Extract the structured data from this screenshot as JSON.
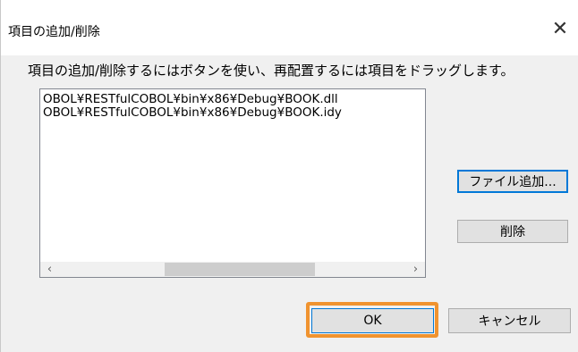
{
  "dialog": {
    "title": "項目の追加/削除",
    "close_symbol": "✕",
    "instruction": "項目の追加/削除するにはボタンを使い、再配置するには項目をドラッグします。"
  },
  "list": {
    "items": [
      "OBOL¥RESTfulCOBOL¥bin¥x86¥Debug¥BOOK.dll",
      "OBOL¥RESTfulCOBOL¥bin¥x86¥Debug¥BOOK.idy"
    ],
    "scroll_left_symbol": "‹",
    "scroll_right_symbol": "›"
  },
  "buttons": {
    "add_file": "ファイル追加...",
    "delete": "削除",
    "ok": "OK",
    "cancel": "キャンセル"
  },
  "colors": {
    "highlight": "#f0932f",
    "focus": "#0078d7"
  }
}
